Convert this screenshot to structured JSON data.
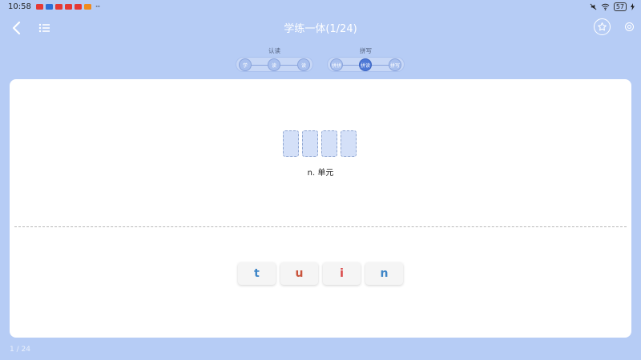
{
  "status_bar": {
    "time": "10:58",
    "notification_icons": [
      {
        "name": "app-icon-red",
        "color": "#e53935"
      },
      {
        "name": "app-icon-blue",
        "color": "#2d6fd6"
      },
      {
        "name": "app-icon-red2",
        "color": "#e53935"
      },
      {
        "name": "app-icon-red3",
        "color": "#e53935"
      },
      {
        "name": "app-icon-red4",
        "color": "#e53935"
      },
      {
        "name": "app-icon-orange",
        "color": "#f08a1c"
      }
    ],
    "more": "···",
    "battery": "57"
  },
  "app_bar": {
    "title": "学练一体(1/24)",
    "back_icon": "chevron-left-icon",
    "menu_icon": "list-icon",
    "favorite_icon": "star-icon",
    "settings_icon": "gear-icon"
  },
  "stages": [
    {
      "label": "认读",
      "steps": [
        {
          "label": "学",
          "active": false
        },
        {
          "label": "读",
          "active": false
        },
        {
          "label": "读",
          "active": false
        }
      ]
    },
    {
      "label": "拼写",
      "steps": [
        {
          "label": "拼拼",
          "active": false
        },
        {
          "label": "拼读",
          "active": true
        },
        {
          "label": "拼写",
          "active": false
        }
      ]
    }
  ],
  "exercise": {
    "slot_count": 4,
    "meaning": "n. 单元",
    "letters": [
      {
        "char": "t",
        "color": "#3f86c7"
      },
      {
        "char": "u",
        "color": "#c9543c"
      },
      {
        "char": "i",
        "color": "#d94747"
      },
      {
        "char": "n",
        "color": "#3f86c7"
      }
    ]
  },
  "pager": "1 / 24",
  "colors": {
    "background": "#b6ccf5",
    "card": "#ffffff",
    "accent": "#4d78d6",
    "slot_fill": "#d4e0f8"
  }
}
